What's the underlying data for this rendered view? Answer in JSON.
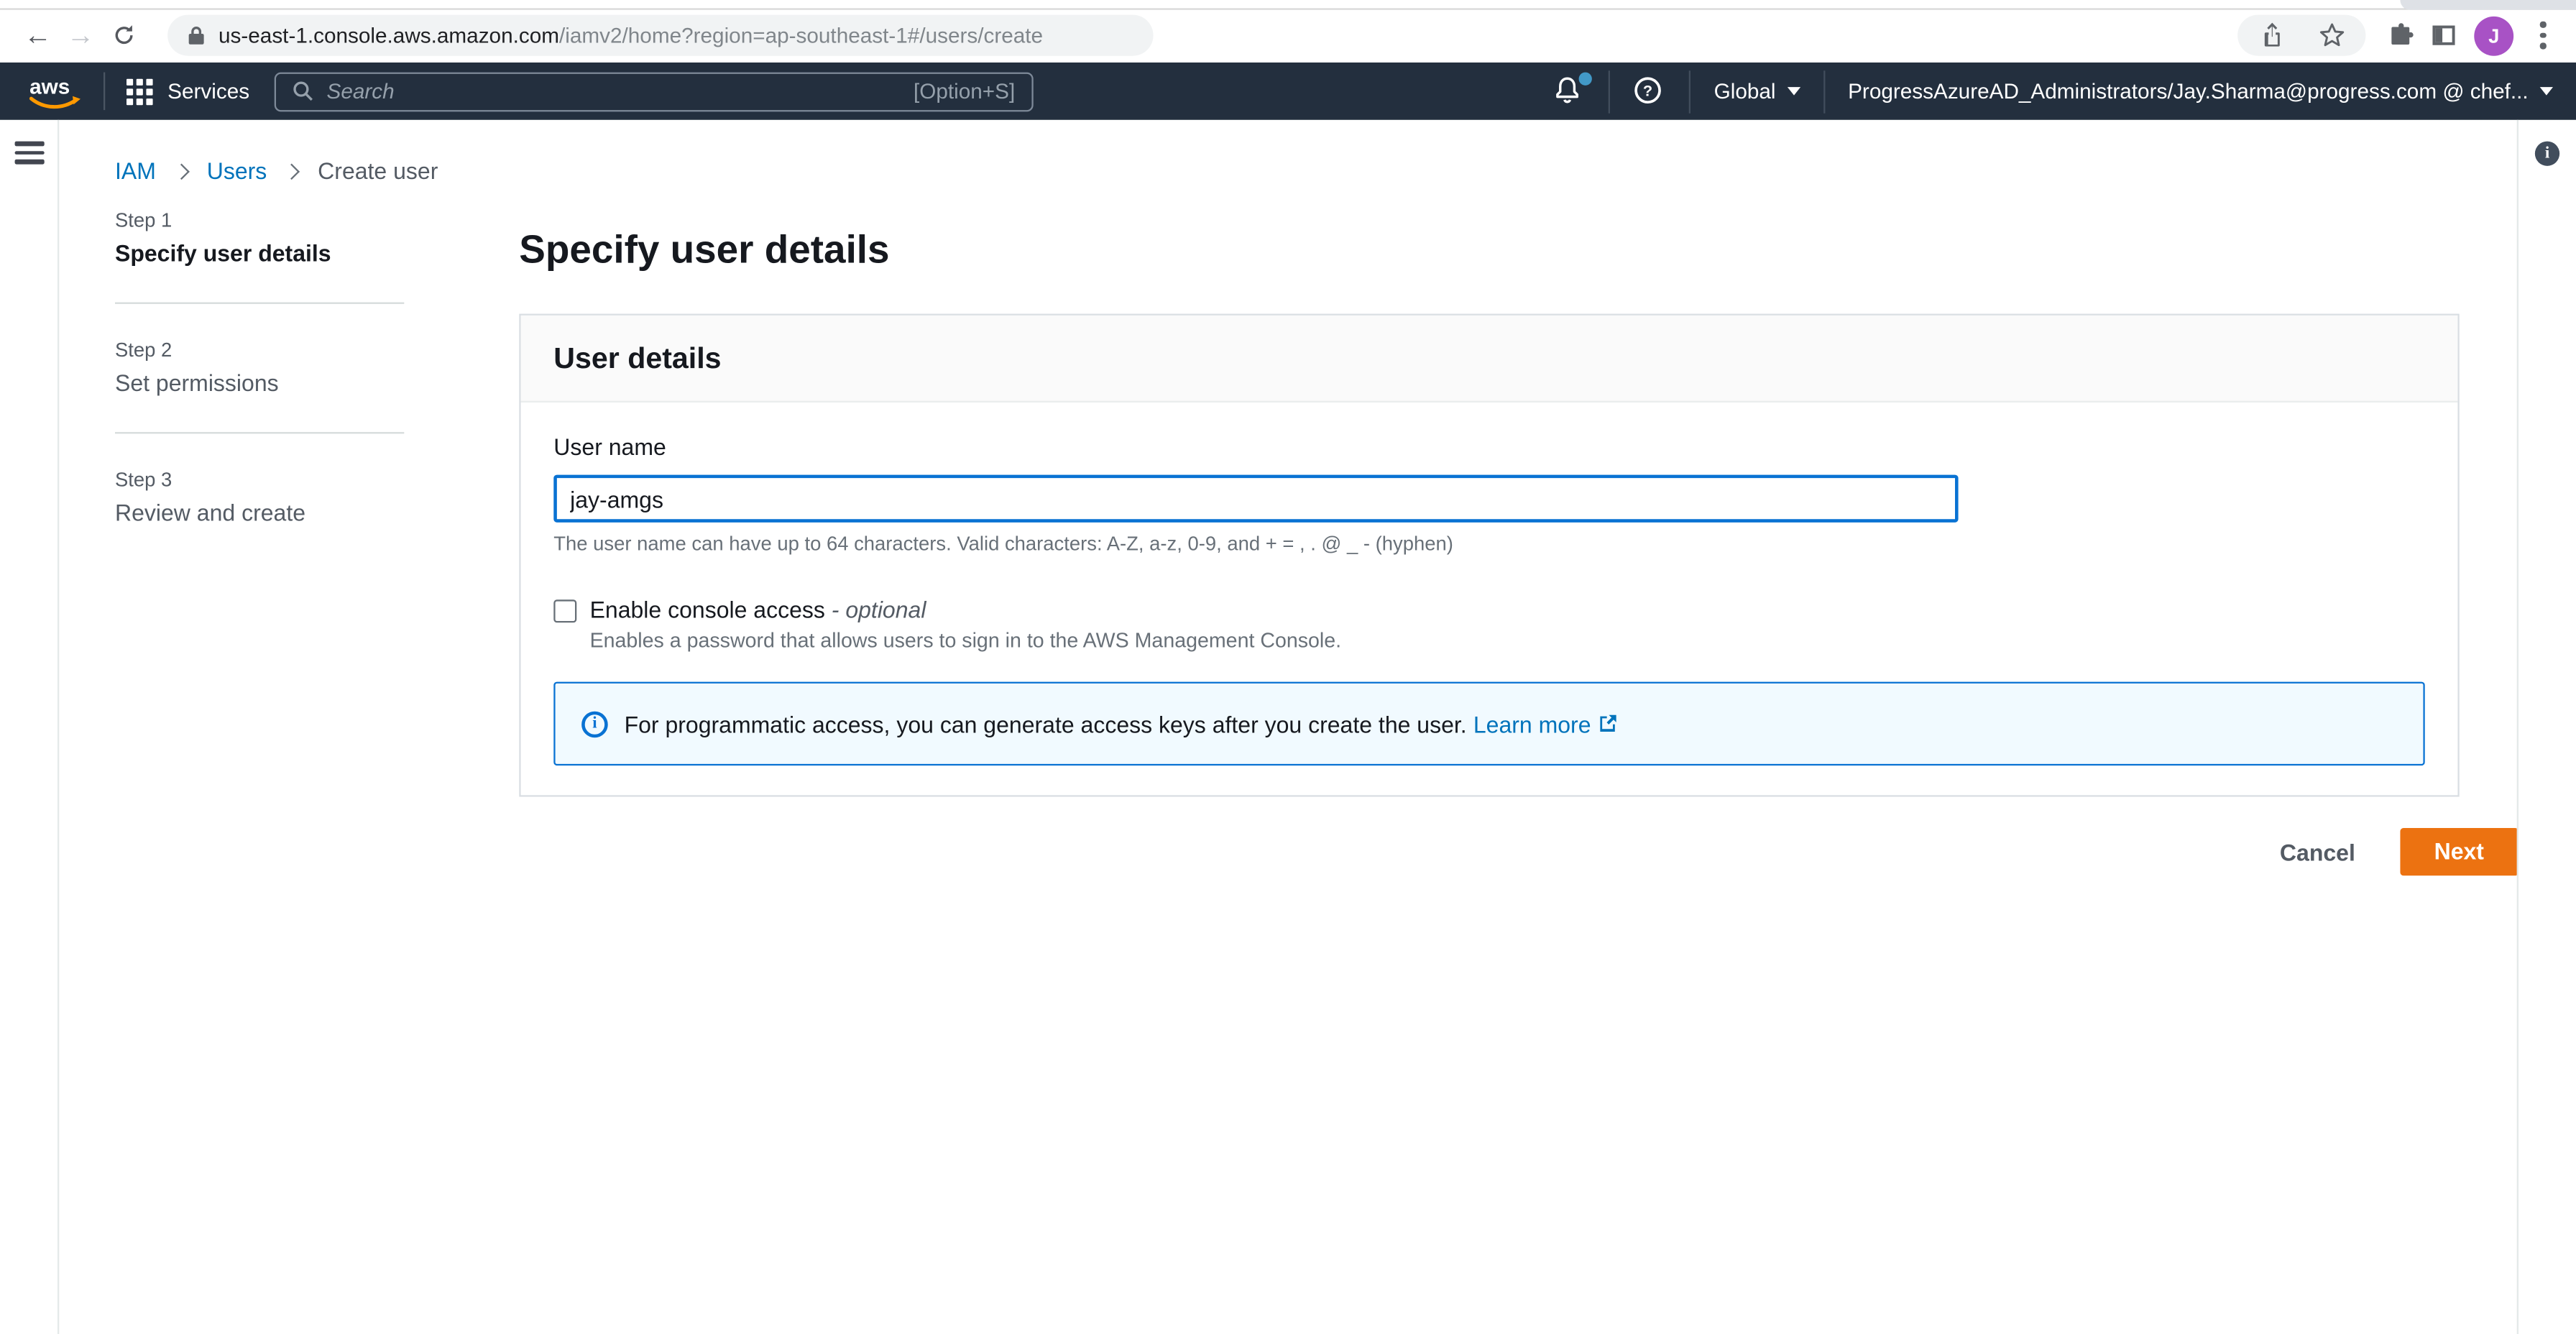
{
  "browser": {
    "url_domain": "us-east-1.console.aws.amazon.com",
    "url_path": "/iamv2/home?region=ap-southeast-1#/users/create",
    "avatar_initial": "J"
  },
  "nav": {
    "logo_text": "aws",
    "services_label": "Services",
    "search_placeholder": "Search",
    "search_shortcut": "[Option+S]",
    "region_label": "Global",
    "account_label": "ProgressAzureAD_Administrators/Jay.Sharma@progress.com @ chef..."
  },
  "breadcrumb": {
    "items": [
      {
        "label": "IAM"
      },
      {
        "label": "Users"
      },
      {
        "label": "Create user"
      }
    ]
  },
  "steps": {
    "items": [
      {
        "step": "Step 1",
        "label": "Specify user details"
      },
      {
        "step": "Step 2",
        "label": "Set permissions"
      },
      {
        "step": "Step 3",
        "label": "Review and create"
      }
    ]
  },
  "page": {
    "title": "Specify user details"
  },
  "form": {
    "card_title": "User details",
    "username_label": "User name",
    "username_value": "jay-amgs",
    "username_help": "The user name can have up to 64 characters. Valid characters: A-Z, a-z, 0-9, and + = , . @ _ - (hyphen)",
    "console_access_label": "Enable console access",
    "console_access_optional": "- optional",
    "console_access_help": "Enables a password that allows users to sign in to the AWS Management Console.",
    "alert_text": "For programmatic access, you can generate access keys after you create the user.",
    "alert_link_label": "Learn more"
  },
  "actions": {
    "cancel_label": "Cancel",
    "next_label": "Next"
  },
  "colors": {
    "nav_bg": "#232f3e",
    "primary_button": "#ec7211",
    "focus_border": "#0972d3",
    "link": "#0073bb",
    "alert_bg": "#f1faff",
    "notification_dot": "#4299c7",
    "avatar_bg": "#a852c5"
  }
}
